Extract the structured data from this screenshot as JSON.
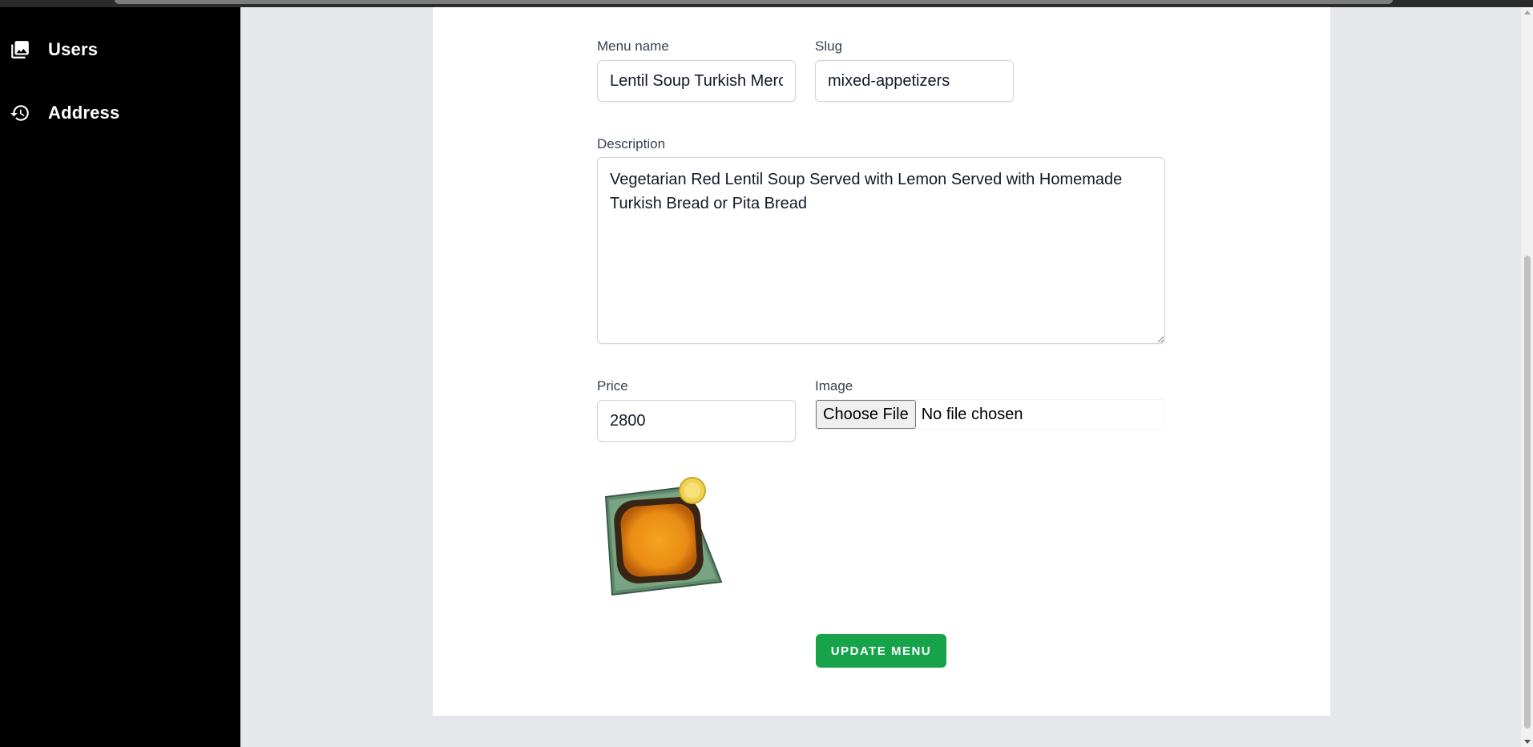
{
  "sidebar": {
    "items": [
      {
        "label": "Users",
        "icon": "photo-library-icon"
      },
      {
        "label": "Address",
        "icon": "history-icon"
      }
    ]
  },
  "form": {
    "menu_name": {
      "label": "Menu name",
      "value": "Lentil Soup Turkish Merc"
    },
    "slug": {
      "label": "Slug",
      "value": "mixed-appetizers"
    },
    "description": {
      "label": "Description",
      "value": "Vegetarian Red Lentil Soup Served with Lemon Served with Homemade Turkish Bread or Pita Bread"
    },
    "price": {
      "label": "Price",
      "value": "2800"
    },
    "image": {
      "label": "Image",
      "button_label": "Choose File",
      "status": "No file chosen"
    },
    "submit_label": "UPDATE MENU"
  },
  "colors": {
    "sidebar_bg": "#000000",
    "page_bg": "#e5e7eb",
    "card_bg": "#ffffff",
    "accent_green": "#16a34a"
  }
}
